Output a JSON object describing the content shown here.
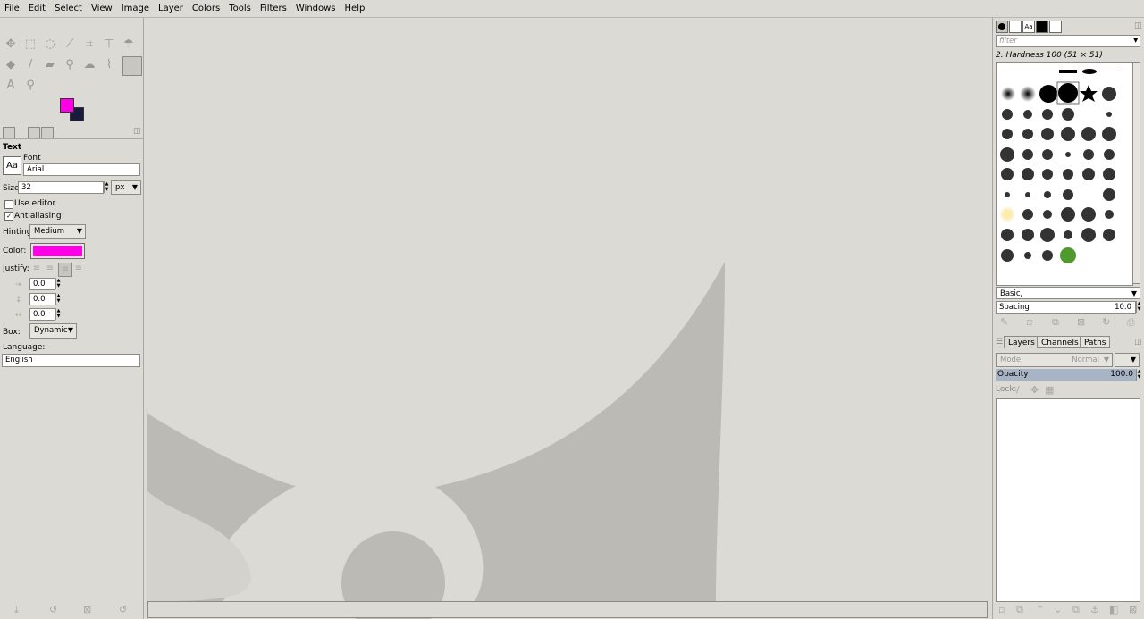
{
  "menubar": [
    "File",
    "Edit",
    "Select",
    "View",
    "Image",
    "Layer",
    "Colors",
    "Tools",
    "Filters",
    "Windows",
    "Help"
  ],
  "tool_options": {
    "title": "Text",
    "font_label": "Font",
    "font_value": "Arial",
    "font_preview": "Aa",
    "size_label": "Size:",
    "size_value": "32",
    "size_unit": "px",
    "use_editor": "Use editor",
    "use_editor_checked": false,
    "antialiasing": "Antialiasing",
    "antialiasing_checked": true,
    "hinting_label": "Hinting:",
    "hinting_value": "Medium",
    "color_label": "Color:",
    "text_color": "#ff00e6",
    "justify_label": "Justify:",
    "indent_value": "0.0",
    "line_spacing_value": "0.0",
    "letter_spacing_value": "0.0",
    "box_label": "Box:",
    "box_value": "Dynamic",
    "language_label": "Language:",
    "language_value": "English"
  },
  "colors": {
    "foreground": "#ff00e6",
    "background": "#1a1a3d"
  },
  "brushes": {
    "filter_placeholder": "filter",
    "selected_brush": "2. Hardness 100 (51 × 51)",
    "tag_value": "Basic,",
    "spacing_label": "Spacing",
    "spacing_value": "10.0"
  },
  "layers": {
    "tabs": [
      "Layers",
      "Channels",
      "Paths"
    ],
    "mode_label": "Mode",
    "mode_value": "Normal",
    "opacity_label": "Opacity",
    "opacity_value": "100.0",
    "lock_label": "Lock:"
  }
}
